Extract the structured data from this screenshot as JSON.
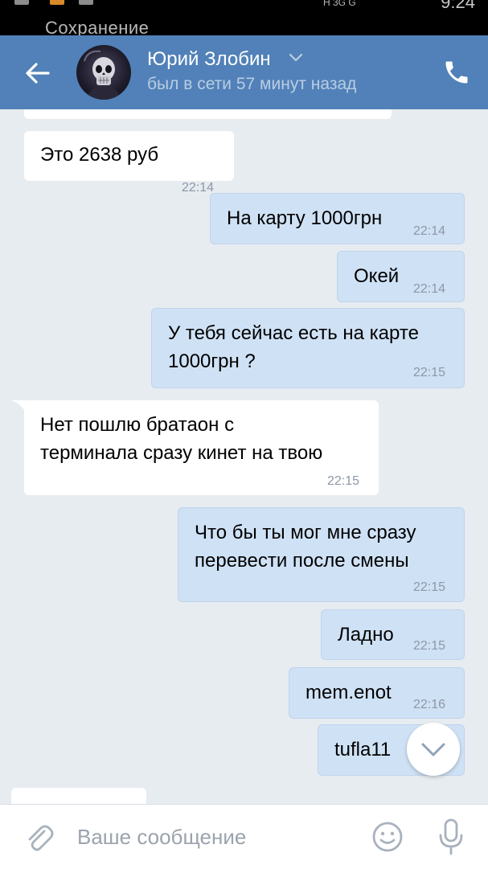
{
  "status_bar": {
    "notification": "Сохранение",
    "network": "H 3G G",
    "time": "9:24"
  },
  "header": {
    "contact_name": "Юрий Злобин",
    "status": "был в сети 57 минут назад"
  },
  "messages": [
    {
      "direction": "in",
      "text": "Это 2638 руб",
      "time": "22:14"
    },
    {
      "direction": "out",
      "text": "На карту 1000грн",
      "time": "22:14"
    },
    {
      "direction": "out",
      "text": "Окей",
      "time": "22:14"
    },
    {
      "direction": "out",
      "text_lines": [
        "У тебя сейчас есть на карте",
        "1000грн ?"
      ],
      "time": "22:15"
    },
    {
      "direction": "in",
      "text_lines": [
        "Нет пошлю братаон с",
        "терминала сразу кинет на твою"
      ],
      "time": "22:15"
    },
    {
      "direction": "out",
      "text_lines": [
        "Что бы ты мог мне сразу",
        "перевести после смены"
      ],
      "time": "22:15"
    },
    {
      "direction": "out",
      "text": "Ладно",
      "time": "22:15"
    },
    {
      "direction": "out",
      "text": "mem.enot",
      "time": "22:16"
    },
    {
      "direction": "out",
      "text": "tufla11",
      "time": ""
    }
  ],
  "input": {
    "placeholder": "Ваше сообщение"
  },
  "icons": {
    "back": "arrow-left-icon",
    "call": "phone-icon",
    "scroll": "chevron-down-icon",
    "attach": "paperclip-icon",
    "emoji": "smiley-icon",
    "mic": "microphone-icon"
  },
  "colors": {
    "header": "#5181b8",
    "chat_background": "#e7ecf1",
    "incoming_bubble": "#ffffff",
    "outgoing_bubble": "#cfe1f5"
  }
}
